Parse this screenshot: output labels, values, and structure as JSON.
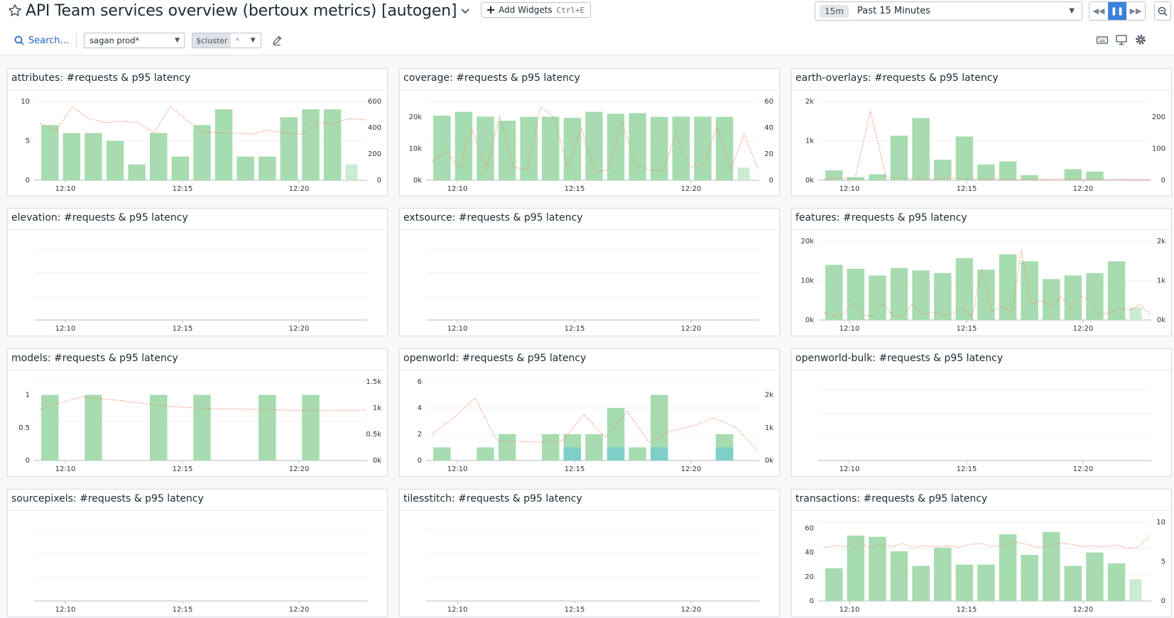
{
  "header": {
    "title": "API Team services overview (bertoux metrics) [autogen]",
    "add_widgets_label": "Add Widgets",
    "add_widgets_shortcut": "Ctrl+E",
    "time_chip": "15m",
    "time_label": "Past 15 Minutes"
  },
  "filters": {
    "search_label": "Search...",
    "scope_value": "sagan prod*",
    "template_var_name": "$cluster",
    "template_var_value": "*"
  },
  "icons": {
    "favorite": "star-icon",
    "title_menu": "chevron-down-icon",
    "add": "plus-icon",
    "rewind": "rewind-icon",
    "pause": "pause-icon",
    "forward": "fast-forward-icon",
    "zoom_out": "zoom-out-icon",
    "search": "search-icon",
    "edit": "pencil-icon",
    "keyboard": "keyboard-icon",
    "tv_mode": "monitor-icon",
    "settings": "gear-icon"
  },
  "colors": {
    "bar": "#a6dcb0",
    "bar_partial": "#cdebd3",
    "bar_alt": "#7ecfc7",
    "latency_line": "#f08c6e",
    "accent": "#3b82d9"
  },
  "x_ticks": [
    "12:10",
    "12:15",
    "12:20"
  ],
  "widgets": [
    {
      "title": "attributes: #requests & p95 latency",
      "chart_data": {
        "type": "bar",
        "y_left": {
          "ticks": [
            "0",
            "5",
            "10"
          ],
          "max": 10
        },
        "y_right": {
          "ticks": [
            "0",
            "200",
            "400",
            "600"
          ],
          "max": 600
        },
        "bars": [
          7,
          6,
          6,
          5,
          2,
          6,
          3,
          7,
          9,
          3,
          3,
          8,
          9,
          9,
          2
        ],
        "line": [
          430,
          380,
          560,
          470,
          440,
          450,
          440,
          360,
          560,
          460,
          370,
          360,
          360,
          350,
          380,
          360,
          350,
          440,
          430,
          470,
          460
        ]
      }
    },
    {
      "title": "coverage: #requests & p95 latency",
      "chart_data": {
        "type": "bar",
        "y_left": {
          "ticks": [
            "0k",
            "10k",
            "20k"
          ],
          "max": 25000
        },
        "y_right": {
          "ticks": [
            "0",
            "20",
            "40",
            "60"
          ],
          "max": 60
        },
        "bars": [
          20500,
          21700,
          20200,
          18900,
          20100,
          20200,
          19800,
          21700,
          21100,
          21300,
          20100,
          20200,
          20200,
          20100,
          4000
        ],
        "line": [
          14,
          22,
          10,
          38,
          8,
          49,
          10,
          8,
          56,
          48,
          10,
          40,
          6,
          8,
          44,
          12,
          8,
          7,
          36,
          10,
          12,
          40,
          8,
          35,
          9
        ]
      }
    },
    {
      "title": "earth-overlays: #requests & p95 latency",
      "chart_data": {
        "type": "bar",
        "y_left": {
          "ticks": [
            "0k",
            "1k",
            "2k"
          ],
          "max": 2000
        },
        "y_right": {
          "ticks": [
            "0",
            "100",
            "200"
          ],
          "max": 250
        },
        "bars": [
          250,
          80,
          150,
          1130,
          1580,
          520,
          1110,
          400,
          480,
          130,
          0,
          280,
          220,
          0,
          0
        ],
        "line": [
          2,
          8,
          4,
          220,
          10,
          6,
          4,
          3,
          8,
          5,
          3,
          4,
          2,
          3,
          2,
          4,
          3,
          2,
          2,
          3,
          2,
          2
        ]
      }
    },
    {
      "title": "elevation: #requests & p95 latency",
      "chart_data": {
        "type": "bar",
        "y_left": {
          "ticks": [],
          "max": 1
        },
        "y_right": {
          "ticks": [],
          "max": 1
        },
        "bars": [],
        "line": []
      }
    },
    {
      "title": "extsource: #requests & p95 latency",
      "chart_data": {
        "type": "bar",
        "y_left": {
          "ticks": [],
          "max": 1
        },
        "y_right": {
          "ticks": [],
          "max": 1
        },
        "bars": [],
        "line": []
      }
    },
    {
      "title": "features: #requests & p95 latency",
      "chart_data": {
        "type": "bar",
        "y_left": {
          "ticks": [
            "0k",
            "10k",
            "20k"
          ],
          "max": 20000
        },
        "y_right": {
          "ticks": [
            "0k",
            "1k",
            "2k"
          ],
          "max": 2000
        },
        "bars": [
          14000,
          13000,
          11300,
          13200,
          12600,
          11900,
          15700,
          12800,
          16700,
          14900,
          10400,
          11300,
          11900,
          14900,
          3200
        ],
        "line": [
          200,
          100,
          150,
          450,
          120,
          100,
          400,
          100,
          120,
          420,
          150,
          200,
          130,
          150,
          300,
          100,
          1300,
          200,
          350,
          200,
          1800,
          400,
          500,
          350,
          600,
          300,
          600,
          500,
          120,
          200,
          300,
          250,
          400,
          150
        ]
      }
    },
    {
      "title": "models: #requests & p95 latency",
      "chart_data": {
        "type": "bar",
        "y_left": {
          "ticks": [
            "0",
            "0.5",
            "1"
          ],
          "max": 1.2
        },
        "y_right": {
          "ticks": [
            "0k",
            "0.5k",
            "1k",
            "1.5k"
          ],
          "max": 1500
        },
        "bars": [
          1,
          0,
          1,
          0,
          0,
          1,
          0,
          1,
          0,
          0,
          1,
          0,
          1,
          0,
          0
        ],
        "line": [
          980,
          1210,
          1140,
          1040,
          990,
          980,
          960,
          950,
          960
        ]
      }
    },
    {
      "title": "openworld: #requests & p95 latency",
      "chart_data": {
        "type": "bar",
        "y_left": {
          "ticks": [
            "0",
            "2",
            "4",
            "6"
          ],
          "max": 6
        },
        "y_right": {
          "ticks": [
            "0k",
            "1k",
            "2k"
          ],
          "max": 2400
        },
        "bars": [
          1,
          0,
          1,
          2,
          0,
          2,
          2,
          2,
          4,
          1,
          5,
          0,
          0,
          2,
          0
        ],
        "bars_alt": [
          0,
          0,
          0,
          0,
          0,
          0,
          1,
          0,
          1,
          0,
          1,
          0,
          0,
          1,
          0
        ],
        "line": [
          800,
          1300,
          1900,
          600,
          580,
          560,
          600,
          1400,
          700,
          1500,
          550,
          900,
          1050,
          1300,
          1000,
          300
        ]
      }
    },
    {
      "title": "openworld-bulk: #requests & p95 latency",
      "chart_data": {
        "type": "bar",
        "y_left": {
          "ticks": [],
          "max": 1
        },
        "y_right": {
          "ticks": [],
          "max": 1
        },
        "bars": [],
        "line": []
      }
    },
    {
      "title": "sourcepixels: #requests & p95 latency",
      "chart_data": {
        "type": "bar",
        "y_left": {
          "ticks": [],
          "max": 1
        },
        "y_right": {
          "ticks": [],
          "max": 1
        },
        "bars": [],
        "line": []
      }
    },
    {
      "title": "tilesstitch: #requests & p95 latency",
      "chart_data": {
        "type": "bar",
        "y_left": {
          "ticks": [],
          "max": 1
        },
        "y_right": {
          "ticks": [],
          "max": 1
        },
        "bars": [],
        "line": []
      }
    },
    {
      "title": "transactions: #requests & p95 latency",
      "chart_data": {
        "type": "bar",
        "y_left": {
          "ticks": [
            "0",
            "20",
            "40",
            "60"
          ],
          "max": 65
        },
        "y_right": {
          "ticks": [
            "0",
            "5",
            "10"
          ],
          "max": 10
        },
        "bars": [
          27,
          54,
          53,
          41,
          29,
          44,
          30,
          30,
          55,
          38,
          57,
          29,
          40,
          31,
          18
        ],
        "line": [
          6.8,
          7,
          6.9,
          7.6,
          6.8,
          7.1,
          6.9,
          7.3,
          6.8,
          7.0,
          6.9,
          7.0,
          6.8,
          7.2,
          7.3,
          6.9,
          7.1,
          7.5,
          7.2,
          6.8,
          7.0,
          7.4,
          7.2,
          6.9,
          7.0,
          6.9,
          7.1,
          6.7,
          6.9,
          8.3
        ]
      }
    }
  ]
}
